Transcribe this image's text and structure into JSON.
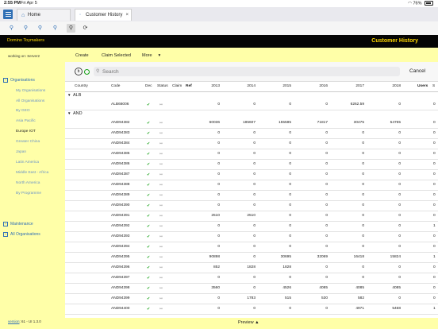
{
  "status_bar": {
    "time": "2:55 PM",
    "date": "Fri Apr 5",
    "battery": "76%"
  },
  "tabs": [
    {
      "label": "Home",
      "icon": "home-icon"
    },
    {
      "label": "Customer History",
      "icon": "document-icon",
      "close": "×"
    }
  ],
  "header": {
    "brand": "Domino Toymakers",
    "title": "Customer History"
  },
  "sidebar": {
    "working_on": "working on: Server2",
    "organisations_label": "Organisations",
    "org_items": [
      "My Organisations",
      "All Organisations",
      "By GEO",
      "Asia Pacific",
      "Europe IOT",
      "Greater China",
      "Japan",
      "Latin America",
      "Middle East - Africa",
      "North America",
      "By Programme"
    ],
    "maintenance_label": "Maintenance",
    "all_orgs_label": "All Organisations",
    "version_link": "version",
    "version_text": ": 61 - UI 1.3.0"
  },
  "actions": {
    "create": "Create",
    "claim_selected": "Claim Selected",
    "more": "More",
    "more_caret": "▾"
  },
  "search": {
    "placeholder": "Search",
    "cancel": "Cancel"
  },
  "columns": [
    "Country",
    "Code",
    "Dec",
    "Status",
    "Claim",
    "Ref",
    "2013",
    "2014",
    "2015",
    "2016",
    "2017",
    "2018",
    "Users",
    "S"
  ],
  "groups": [
    {
      "name": "ALB",
      "rows": [
        {
          "code": "ALB66006",
          "v": [
            "0",
            "0",
            "0",
            "0",
            "6262.59",
            "0"
          ],
          "u": "0"
        }
      ]
    },
    {
      "name": "AND",
      "rows": [
        {
          "code": "AND94382",
          "v": [
            "60036",
            "185607",
            "155585",
            "71817",
            "30475",
            "54765"
          ],
          "u": "0"
        },
        {
          "code": "AND94383",
          "v": [
            "0",
            "0",
            "0",
            "0",
            "0",
            "0"
          ],
          "u": "0"
        },
        {
          "code": "AND94384",
          "v": [
            "0",
            "0",
            "0",
            "0",
            "0",
            "0"
          ],
          "u": "0"
        },
        {
          "code": "AND94385",
          "v": [
            "0",
            "0",
            "0",
            "0",
            "0",
            "0"
          ],
          "u": "0"
        },
        {
          "code": "AND94386",
          "v": [
            "0",
            "0",
            "0",
            "0",
            "0",
            "0"
          ],
          "u": "0"
        },
        {
          "code": "AND94387",
          "v": [
            "0",
            "0",
            "0",
            "0",
            "0",
            "0"
          ],
          "u": "0"
        },
        {
          "code": "AND94388",
          "v": [
            "0",
            "0",
            "0",
            "0",
            "0",
            "0"
          ],
          "u": "0"
        },
        {
          "code": "AND94389",
          "v": [
            "0",
            "0",
            "0",
            "0",
            "0",
            "0"
          ],
          "u": "0"
        },
        {
          "code": "AND94390",
          "v": [
            "0",
            "0",
            "0",
            "0",
            "0",
            "0"
          ],
          "u": "0"
        },
        {
          "code": "AND94391",
          "v": [
            "2510",
            "2510",
            "0",
            "0",
            "0",
            "0"
          ],
          "u": "0"
        },
        {
          "code": "AND94392",
          "v": [
            "0",
            "0",
            "0",
            "0",
            "0",
            "0"
          ],
          "u": "1"
        },
        {
          "code": "AND94393",
          "v": [
            "0",
            "0",
            "0",
            "0",
            "0",
            "0"
          ],
          "u": "0"
        },
        {
          "code": "AND94394",
          "v": [
            "0",
            "0",
            "0",
            "0",
            "0",
            "0"
          ],
          "u": "0"
        },
        {
          "code": "AND94395",
          "v": [
            "90898",
            "0",
            "30695",
            "32069",
            "16418",
            "15824"
          ],
          "u": "1"
        },
        {
          "code": "AND94396",
          "v": [
            "852",
            "1828",
            "1828",
            "0",
            "0",
            "0"
          ],
          "u": "0"
        },
        {
          "code": "AND94397",
          "v": [
            "0",
            "0",
            "0",
            "0",
            "0",
            "0"
          ],
          "u": "0"
        },
        {
          "code": "AND94398",
          "v": [
            "3560",
            "0",
            "4526",
            "4085",
            "4085",
            "4085"
          ],
          "u": "0"
        },
        {
          "code": "AND94399",
          "v": [
            "0",
            "1783",
            "515",
            "530",
            "582",
            "0"
          ],
          "u": "0"
        },
        {
          "code": "AND94400",
          "v": [
            "0",
            "0",
            "0",
            "0",
            "4971",
            "5468"
          ],
          "u": "1"
        }
      ]
    }
  ],
  "footer": {
    "preview": "Preview ▲"
  }
}
